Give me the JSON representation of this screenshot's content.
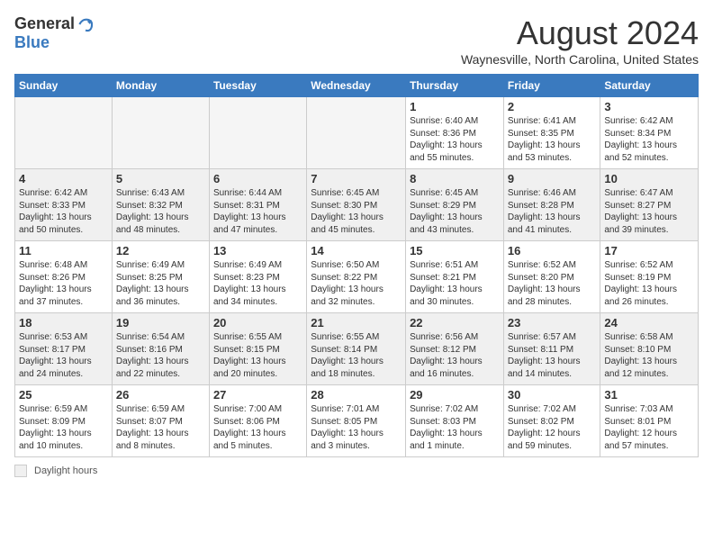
{
  "header": {
    "logo_general": "General",
    "logo_blue": "Blue",
    "month_title": "August 2024",
    "location": "Waynesville, North Carolina, United States"
  },
  "days_of_week": [
    "Sunday",
    "Monday",
    "Tuesday",
    "Wednesday",
    "Thursday",
    "Friday",
    "Saturday"
  ],
  "weeks": [
    [
      {
        "day": "",
        "info": "",
        "empty": true
      },
      {
        "day": "",
        "info": "",
        "empty": true
      },
      {
        "day": "",
        "info": "",
        "empty": true
      },
      {
        "day": "",
        "info": "",
        "empty": true
      },
      {
        "day": "1",
        "info": "Sunrise: 6:40 AM\nSunset: 8:36 PM\nDaylight: 13 hours\nand 55 minutes.",
        "empty": false
      },
      {
        "day": "2",
        "info": "Sunrise: 6:41 AM\nSunset: 8:35 PM\nDaylight: 13 hours\nand 53 minutes.",
        "empty": false
      },
      {
        "day": "3",
        "info": "Sunrise: 6:42 AM\nSunset: 8:34 PM\nDaylight: 13 hours\nand 52 minutes.",
        "empty": false
      }
    ],
    [
      {
        "day": "4",
        "info": "Sunrise: 6:42 AM\nSunset: 8:33 PM\nDaylight: 13 hours\nand 50 minutes.",
        "empty": false,
        "shaded": true
      },
      {
        "day": "5",
        "info": "Sunrise: 6:43 AM\nSunset: 8:32 PM\nDaylight: 13 hours\nand 48 minutes.",
        "empty": false,
        "shaded": true
      },
      {
        "day": "6",
        "info": "Sunrise: 6:44 AM\nSunset: 8:31 PM\nDaylight: 13 hours\nand 47 minutes.",
        "empty": false,
        "shaded": true
      },
      {
        "day": "7",
        "info": "Sunrise: 6:45 AM\nSunset: 8:30 PM\nDaylight: 13 hours\nand 45 minutes.",
        "empty": false,
        "shaded": true
      },
      {
        "day": "8",
        "info": "Sunrise: 6:45 AM\nSunset: 8:29 PM\nDaylight: 13 hours\nand 43 minutes.",
        "empty": false,
        "shaded": true
      },
      {
        "day": "9",
        "info": "Sunrise: 6:46 AM\nSunset: 8:28 PM\nDaylight: 13 hours\nand 41 minutes.",
        "empty": false,
        "shaded": true
      },
      {
        "day": "10",
        "info": "Sunrise: 6:47 AM\nSunset: 8:27 PM\nDaylight: 13 hours\nand 39 minutes.",
        "empty": false,
        "shaded": true
      }
    ],
    [
      {
        "day": "11",
        "info": "Sunrise: 6:48 AM\nSunset: 8:26 PM\nDaylight: 13 hours\nand 37 minutes.",
        "empty": false
      },
      {
        "day": "12",
        "info": "Sunrise: 6:49 AM\nSunset: 8:25 PM\nDaylight: 13 hours\nand 36 minutes.",
        "empty": false
      },
      {
        "day": "13",
        "info": "Sunrise: 6:49 AM\nSunset: 8:23 PM\nDaylight: 13 hours\nand 34 minutes.",
        "empty": false
      },
      {
        "day": "14",
        "info": "Sunrise: 6:50 AM\nSunset: 8:22 PM\nDaylight: 13 hours\nand 32 minutes.",
        "empty": false
      },
      {
        "day": "15",
        "info": "Sunrise: 6:51 AM\nSunset: 8:21 PM\nDaylight: 13 hours\nand 30 minutes.",
        "empty": false
      },
      {
        "day": "16",
        "info": "Sunrise: 6:52 AM\nSunset: 8:20 PM\nDaylight: 13 hours\nand 28 minutes.",
        "empty": false
      },
      {
        "day": "17",
        "info": "Sunrise: 6:52 AM\nSunset: 8:19 PM\nDaylight: 13 hours\nand 26 minutes.",
        "empty": false
      }
    ],
    [
      {
        "day": "18",
        "info": "Sunrise: 6:53 AM\nSunset: 8:17 PM\nDaylight: 13 hours\nand 24 minutes.",
        "empty": false,
        "shaded": true
      },
      {
        "day": "19",
        "info": "Sunrise: 6:54 AM\nSunset: 8:16 PM\nDaylight: 13 hours\nand 22 minutes.",
        "empty": false,
        "shaded": true
      },
      {
        "day": "20",
        "info": "Sunrise: 6:55 AM\nSunset: 8:15 PM\nDaylight: 13 hours\nand 20 minutes.",
        "empty": false,
        "shaded": true
      },
      {
        "day": "21",
        "info": "Sunrise: 6:55 AM\nSunset: 8:14 PM\nDaylight: 13 hours\nand 18 minutes.",
        "empty": false,
        "shaded": true
      },
      {
        "day": "22",
        "info": "Sunrise: 6:56 AM\nSunset: 8:12 PM\nDaylight: 13 hours\nand 16 minutes.",
        "empty": false,
        "shaded": true
      },
      {
        "day": "23",
        "info": "Sunrise: 6:57 AM\nSunset: 8:11 PM\nDaylight: 13 hours\nand 14 minutes.",
        "empty": false,
        "shaded": true
      },
      {
        "day": "24",
        "info": "Sunrise: 6:58 AM\nSunset: 8:10 PM\nDaylight: 13 hours\nand 12 minutes.",
        "empty": false,
        "shaded": true
      }
    ],
    [
      {
        "day": "25",
        "info": "Sunrise: 6:59 AM\nSunset: 8:09 PM\nDaylight: 13 hours\nand 10 minutes.",
        "empty": false
      },
      {
        "day": "26",
        "info": "Sunrise: 6:59 AM\nSunset: 8:07 PM\nDaylight: 13 hours\nand 8 minutes.",
        "empty": false
      },
      {
        "day": "27",
        "info": "Sunrise: 7:00 AM\nSunset: 8:06 PM\nDaylight: 13 hours\nand 5 minutes.",
        "empty": false
      },
      {
        "day": "28",
        "info": "Sunrise: 7:01 AM\nSunset: 8:05 PM\nDaylight: 13 hours\nand 3 minutes.",
        "empty": false
      },
      {
        "day": "29",
        "info": "Sunrise: 7:02 AM\nSunset: 8:03 PM\nDaylight: 13 hours\nand 1 minute.",
        "empty": false
      },
      {
        "day": "30",
        "info": "Sunrise: 7:02 AM\nSunset: 8:02 PM\nDaylight: 12 hours\nand 59 minutes.",
        "empty": false
      },
      {
        "day": "31",
        "info": "Sunrise: 7:03 AM\nSunset: 8:01 PM\nDaylight: 12 hours\nand 57 minutes.",
        "empty": false
      }
    ]
  ],
  "footer": {
    "box_label": "Daylight hours"
  }
}
